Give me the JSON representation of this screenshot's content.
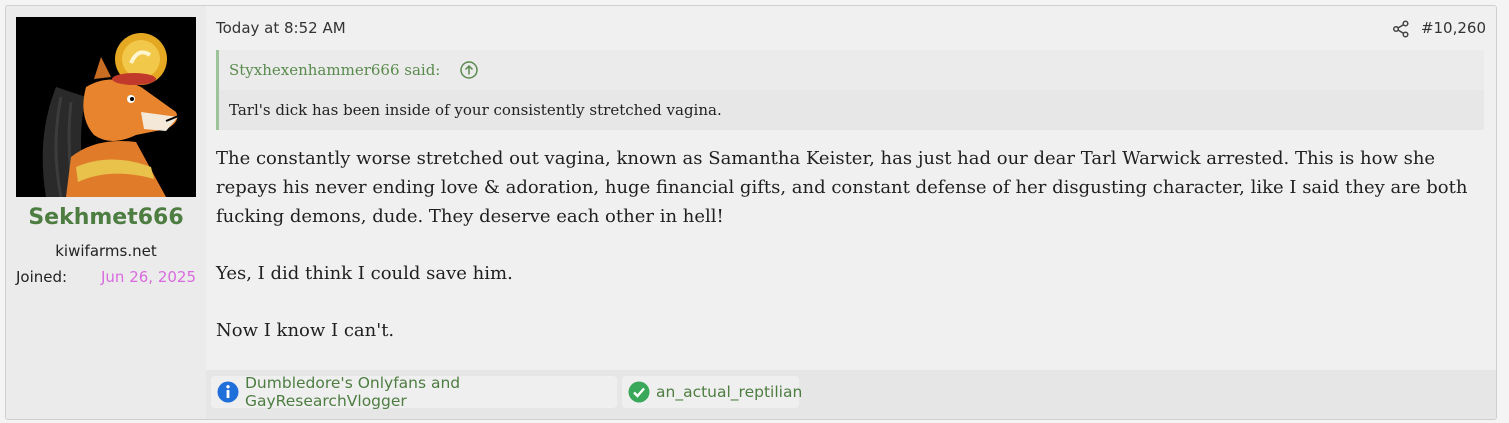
{
  "user": {
    "username": "Sekhmet666",
    "title": "kiwifarms.net",
    "joined_label": "Joined:",
    "joined_date": "Jun 26, 2025"
  },
  "post": {
    "timestamp": "Today at 8:52 AM",
    "number": "#10,260",
    "share_icon": "share-icon",
    "quote": {
      "author_said": "Styxhexenhammer666 said:",
      "jump_icon": "arrow-up-circle-icon",
      "text": "Tarl's dick has been inside of your consistently stretched vagina."
    },
    "paragraphs": [
      "The constantly worse stretched out vagina, known as Samantha Keister, has just had our dear Tarl Warwick arrested. This is how she repays his never ending love & adoration, huge financial gifts, and constant defense of her disgusting character, like I said they are both fucking demons, dude. They deserve each other in hell!",
      "Yes, I did think I could save him.",
      "Now I know I can't."
    ]
  },
  "reactions": [
    {
      "icon": "info-icon",
      "color": "#1e6fd9",
      "label": "Dumbledore's Onlyfans and GayResearchVlogger"
    },
    {
      "icon": "check-circle-icon",
      "color": "#3aa85a",
      "label": "an_actual_reptilian"
    }
  ]
}
